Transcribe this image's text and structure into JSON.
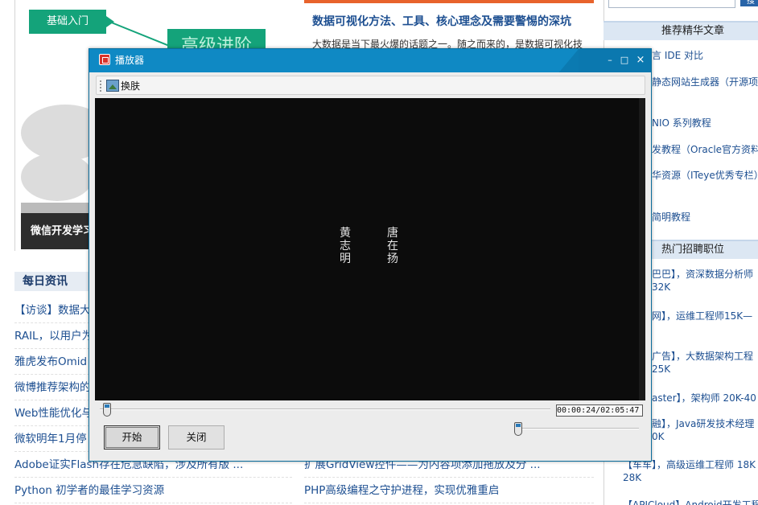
{
  "background": {
    "promo": {
      "tag_basic": "基础入门",
      "tag_advanced": "高级进阶",
      "bar_label": "微信开发学习"
    },
    "daily": {
      "heading": "每日资讯",
      "items": [
        "【访谈】数据大",
        "RAIL，以用户为",
        "雅虎发布Omid",
        "微博推荐架构的",
        "Web性能优化与",
        "微软明年1月停",
        "Adobe证实Flash存在危急缺陷，涉及所有版 ...",
        "Python 初学者的最佳学习资源"
      ]
    },
    "middle": {
      "title": "数据可视化方法、工具、核心理念及需要警惕的深坑",
      "desc": "大数据是当下最火爆的话题之一。随之而来的，是数据可视化技",
      "items": [
        "扩展GridView控件——为内容项添加拖放及分 ...",
        "PHP高级编程之守护进程，实现优雅重启"
      ]
    },
    "right": {
      "search_button": "搜",
      "recommended_heading": "推荐精华文章",
      "recommended_items": [
        "言 IDE 对比",
        "静态网站生成器（开源项",
        "NIO 系列教程",
        "发教程（Oracle官方资料",
        "华资源（ITeye优秀专栏）",
        "简明教程"
      ],
      "jobs_heading": "热门招聘职位",
      "job_items": [
        "巴巴】，资深数据分析师",
        "32K",
        "网】，运维工程师15K—",
        "广告】，大数据架构工程",
        "25K",
        "aster】，架构师 20K-40",
        "融】，Java研发技术经理",
        "0K",
        "【车车】，高级运维工程师 18K",
        "28K",
        "【APICloud】Android开发工程"
      ]
    }
  },
  "player": {
    "title": "播放器",
    "window_buttons": {
      "minimize": "–",
      "maximize": "□",
      "close": "×"
    },
    "toolbar": {
      "skin_label": "换肤"
    },
    "video_text": {
      "right_name": "唐在扬",
      "left_name": "黄志明"
    },
    "time_display": "00:00:24/02:05:47",
    "progress_fraction": 0.0032,
    "volume_fraction": 0.0,
    "start_button": "开始",
    "close_button": "关闭"
  }
}
